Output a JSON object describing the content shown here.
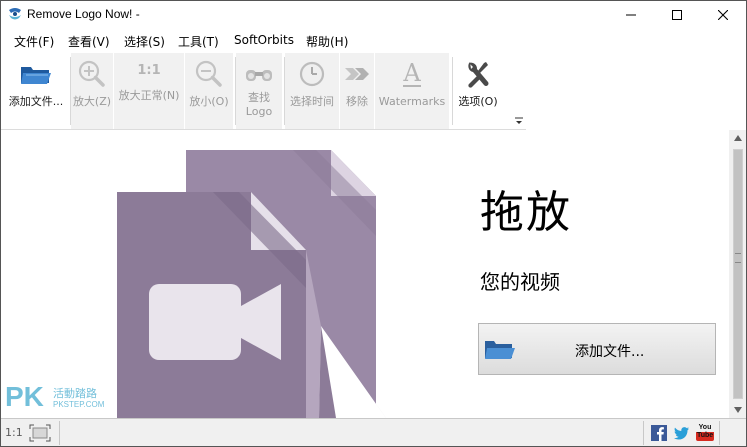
{
  "window": {
    "title": "Remove Logo Now! -"
  },
  "menu": {
    "items": [
      {
        "label": "文件(F)"
      },
      {
        "label": "查看(V)"
      },
      {
        "label": "选择(S)"
      },
      {
        "label": "工具(T)"
      },
      {
        "label": "SoftOrbits"
      },
      {
        "label": "帮助(H)"
      }
    ]
  },
  "toolbar": {
    "buttons": [
      {
        "label": "添加文件...",
        "icon": "folder-open-icon",
        "enabled": true
      },
      {
        "label": "放大(Z)",
        "icon": "zoom-in-icon",
        "enabled": false
      },
      {
        "label": "放大正常(N)",
        "icon": "zoom-normal-icon",
        "icon_text": "1:1",
        "enabled": false
      },
      {
        "label": "放小(O)",
        "icon": "zoom-out-icon",
        "enabled": false
      },
      {
        "label": "查找",
        "label2": "Logo",
        "icon": "binoculars-icon",
        "enabled": false
      },
      {
        "label": "选择时间",
        "icon": "clock-icon",
        "enabled": false
      },
      {
        "label": "移除",
        "icon": "arrow-right-icon",
        "enabled": false
      },
      {
        "label": "Watermarks",
        "icon": "text-a-icon",
        "icon_text": "A",
        "enabled": false
      },
      {
        "label": "选项(O)",
        "icon": "wrench-icon",
        "enabled": true
      }
    ]
  },
  "drop_area": {
    "title": "拖放",
    "subtitle": "您的视频",
    "add_button": "添加文件..."
  },
  "statusbar": {
    "zoom": "1:1",
    "social": [
      "facebook-icon",
      "twitter-icon",
      "youtube-icon"
    ],
    "youtube_text": "You Tube"
  },
  "watermark": {
    "logo": "PK",
    "caption": "活動踏路",
    "caption_sub": "PKSTEP.COM"
  },
  "colors": {
    "accent_purple": "#8c7b98",
    "light_purple": "#b6a7bf",
    "pale_purple": "#e7e1ea",
    "folder_blue": "#2d6db5",
    "disabled_gray": "#9a9a9a",
    "watermark_blue": "#5ab4d4"
  }
}
